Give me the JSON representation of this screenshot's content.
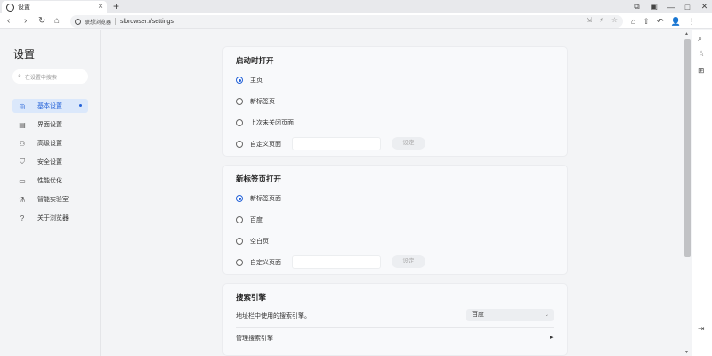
{
  "tab": {
    "title": "设置",
    "close": "×",
    "favicon": "gear-icon"
  },
  "new_tab": "+",
  "window_controls": [
    "⧉",
    "▣",
    "—",
    "□",
    "✕"
  ],
  "toolbar": {
    "back": "‹",
    "forward": "›",
    "reload": "↻",
    "home": "⌂",
    "security_label": "联想浏览器",
    "url": "slbrowser://settings",
    "address_icons": [
      "⇲",
      "⚡",
      "☆"
    ],
    "right_icons": [
      "⌂",
      "⇧",
      "↶",
      "👤",
      "⋮"
    ]
  },
  "sidebar": {
    "title": "设置",
    "search_placeholder": "在设置中搜索",
    "items": [
      {
        "label": "基本设置",
        "icon": "◎",
        "active": true
      },
      {
        "label": "界面设置",
        "icon": "▤",
        "active": false
      },
      {
        "label": "高级设置",
        "icon": "⚇",
        "active": false
      },
      {
        "label": "安全设置",
        "icon": "⛉",
        "active": false
      },
      {
        "label": "性能优化",
        "icon": "▭",
        "active": false
      },
      {
        "label": "智能实验室",
        "icon": "⚗",
        "active": false
      },
      {
        "label": "关于浏览器",
        "icon": "?",
        "active": false
      }
    ]
  },
  "startup": {
    "title": "启动时打开",
    "options": [
      "主页",
      "新标签页",
      "上次未关闭页面",
      "自定义页面"
    ],
    "selected": 0,
    "set_button": "设定"
  },
  "newtab": {
    "title": "新标签页打开",
    "options": [
      "新标签页面",
      "百度",
      "空白页",
      "自定义页面"
    ],
    "selected": 0,
    "set_button": "设定"
  },
  "search_engine": {
    "title": "搜索引擎",
    "address_bar_label": "地址栏中使用的搜索引擎。",
    "engine": "百度",
    "manage_label": "管理搜索引擎"
  },
  "right_panel_icons": [
    "⌕",
    "☆",
    "⊞",
    "⇥"
  ],
  "scrollbar": {
    "up": "▲",
    "down": "▼"
  }
}
